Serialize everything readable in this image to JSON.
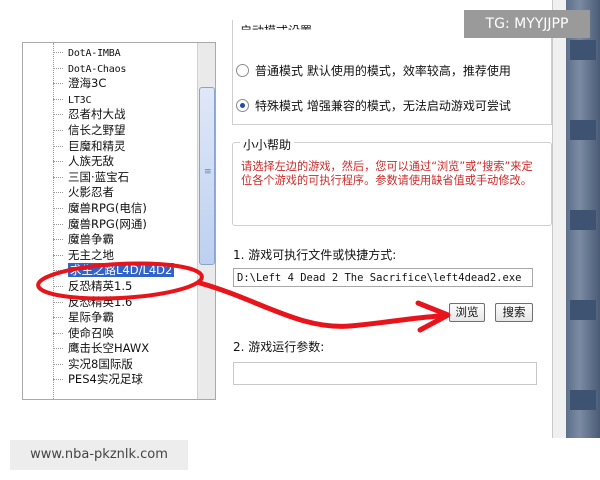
{
  "tree": {
    "items": [
      {
        "label": "DotA-IMBA",
        "latin": true
      },
      {
        "label": "DotA-Chaos",
        "latin": true
      },
      {
        "label": "澄海3C"
      },
      {
        "label": "LT3C",
        "latin": true
      },
      {
        "label": "忍者村大战"
      },
      {
        "label": "信长之野望"
      },
      {
        "label": "巨魔和精灵"
      },
      {
        "label": "人族无敌"
      },
      {
        "label": "三国·蓝宝石"
      },
      {
        "label": "火影忍者"
      },
      {
        "label": "魔兽RPG(电信)"
      },
      {
        "label": "魔兽RPG(网通)"
      },
      {
        "label": "魔兽争霸"
      },
      {
        "label": "无主之地"
      },
      {
        "label": "求生之路L4D/L4D2",
        "selected": true
      },
      {
        "label": "反恐精英1.5"
      },
      {
        "label": "反恐精英1.6"
      },
      {
        "label": "星际争霸"
      },
      {
        "label": "使命召唤"
      },
      {
        "label": "鹰击长空HAWX"
      },
      {
        "label": "实况8国际版"
      },
      {
        "label": "PES4实况足球"
      }
    ]
  },
  "modes": {
    "title": "启动模式设置",
    "normal_label": "普通模式 默认使用的模式，效率较高，推荐使用",
    "special_label": "特殊模式 增强兼容的模式，无法启动游戏可尝试",
    "selected": "special"
  },
  "help": {
    "title": "小小帮助",
    "text": "请选择左边的游戏，然后，您可以通过“浏览”或“搜索”来定位各个游戏的可执行程序。参数请使用缺省值或手动修改。"
  },
  "exe": {
    "label": "1. 游戏可执行文件或快捷方式:",
    "value": "D:\\Left 4 Dead 2 The Sacrifice\\left4dead2.exe",
    "browse_label": "浏览",
    "search_label": "搜索"
  },
  "args": {
    "label": "2. 游戏运行参数:",
    "value": ""
  },
  "overlay": {
    "tg_badge": "TG: MYYJJPP",
    "watermark": "www.nba-pkznlk.com",
    "annotation_color": "#e8141b",
    "selection_color": "#3163c9",
    "help_text_color": "#cc2a2a"
  }
}
